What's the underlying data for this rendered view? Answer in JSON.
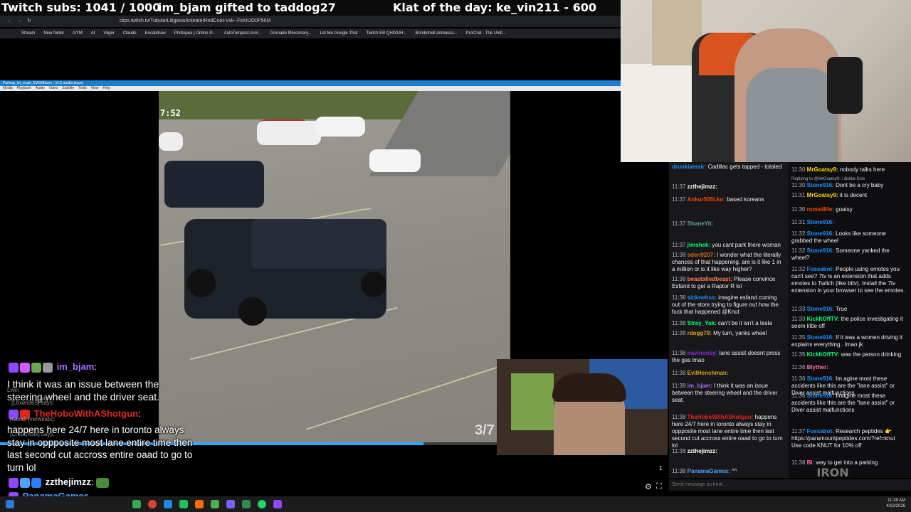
{
  "banner": {
    "subs": "Twitch subs: 1041 / 1000",
    "gift": "im_bjam gifted to taddog27",
    "klat": "Klat of the day: ke_vin211 - 600"
  },
  "browser": {
    "url": "clips.twitch.tv/TubularLitigiousAnteaterRedCoat-Vxk--FsKtUO0P56M",
    "bookmarks": [
      "Stream",
      "New folder",
      "GYM",
      "AI",
      "Vliger",
      "Claude",
      "Excalidraw",
      "Photopea | Online P...",
      "AutoTempest.com...",
      "Grenade Mercenary...",
      "Let Me Google That",
      "Twitch EB QHD/UH...",
      "Bombshell ambassa...",
      "ProChat - The Unifi..."
    ]
  },
  "vlc": {
    "title": "Parking_lot_crash_EW3rBlsmx - VLC media player",
    "menu": [
      "Media",
      "Playback",
      "Audio",
      "Video",
      "Subtitle",
      "Tools",
      "View",
      "Help"
    ],
    "timestamp": "7:52",
    "frame_label": "3/7",
    "progress": 0.85
  },
  "overlay_chat": [
    {
      "user": "im_bjam",
      "user_color": "#a970ff",
      "text": "I think it was an issue between the steering wheel and the driver seat."
    },
    {
      "user": "TheHoboWithAShotgun",
      "user_color": "#e0271f",
      "text": "happens here 24/7 here in toronto always stay in oppposite most lane entire time then last second cut accross entire oaad to go to turn lol"
    },
    {
      "user": "zzthejimzz",
      "user_color": "#ffffff",
      "text": ""
    },
    {
      "user": "PanamaGames",
      "user_color": "#4da3ff",
      "text": ""
    }
  ],
  "overlay_ghost": [
    "Lwin",
    "Cwlg",
    "[Ltown965] says:",
    "[Guild] [verwindx]:",
    "[CrustyMilk] says:"
  ],
  "overlay_number": "1",
  "chat_left": [
    {
      "time": "",
      "user": "drunkiamsir",
      "color": "#1e90ff",
      "text": "Cadillac gets tapped - totaled"
    },
    {
      "time": "11:37",
      "user": "zzthejimzz",
      "color": "#ffffff",
      "text": ""
    },
    {
      "time": "11:37",
      "user": "Ankur505Lko",
      "color": "#ff4500",
      "text": "based koreans"
    },
    {
      "time": "11:37",
      "user": "ShaneYit",
      "color": "#5f9ea0",
      "text": ""
    },
    {
      "time": "11:37",
      "user": "jimshek",
      "color": "#00ff7f",
      "text": "you cant park there woman"
    },
    {
      "time": "11:38",
      "user": "sden9207",
      "color": "#d2691e",
      "text": "I wonder what the literally chances of that happening. are is it like 1 in a million or is it like way higher?"
    },
    {
      "time": "11:38",
      "user": "beastafiedbeast",
      "color": "#ff7f50",
      "text": "Please convince Esfand to get a Raptor R lol"
    },
    {
      "time": "11:38",
      "user": "sicknehss",
      "color": "#1e90ff",
      "text": "imagine esfand coming out of the store trying to figure out how the fuck that happened @Knut"
    },
    {
      "time": "11:38",
      "user": "Stray_Yak",
      "color": "#00ff7f",
      "text": "can't be it isn't a tesla"
    },
    {
      "time": "11:38",
      "user": "rdogg79",
      "color": "#daa520",
      "text": "My turn, yanks wheel"
    },
    {
      "time": "11:38",
      "user": "navinooby",
      "color": "#8a2be2",
      "text": "lane assist doesnt press the gas lmao"
    },
    {
      "time": "11:38",
      "user": "EvilHenchman",
      "color": "#daa520",
      "text": ""
    },
    {
      "time": "11:38",
      "user": "im_bjam",
      "color": "#a970ff",
      "text": "I think it was an issue between the steering wheel and the driver seat."
    },
    {
      "time": "11:38",
      "user": "TheHoboWithAShotgun",
      "color": "#e0271f",
      "text": "happens here 24/7 here in toronto always stay in oppposite most lane entire time then last second cut accross entire oaad to go to turn lol"
    },
    {
      "time": "11:38",
      "user": "zzthejimzz",
      "color": "#ffffff",
      "text": ""
    },
    {
      "time": "11:38",
      "user": "PanamaGames",
      "color": "#4da3ff",
      "text": "^^"
    }
  ],
  "chat_right": [
    {
      "time": "11:30",
      "user": "MrGoatsy9",
      "color": "#ffd700",
      "text": "nobody talks here"
    },
    {
      "time": "",
      "user": "",
      "color": "#adadb8",
      "text": "Replying to @MrGoatsy9: i dislike Kick"
    },
    {
      "time": "11:30",
      "user": "Stone916",
      "color": "#1e90ff",
      "text": "Dont be a cry baby"
    },
    {
      "time": "11:31",
      "user": "MrGoatsy9",
      "color": "#ffd700",
      "text": "it is decent"
    },
    {
      "time": "11:30",
      "user": "rome4life",
      "color": "#ff4500",
      "text": "goatsy"
    },
    {
      "time": "11:31",
      "user": "Stone916",
      "color": "#1e90ff",
      "text": ""
    },
    {
      "time": "11:32",
      "user": "Stone916",
      "color": "#1e90ff",
      "text": "Looks like someone grabbed the wheel"
    },
    {
      "time": "11:32",
      "user": "Stone916",
      "color": "#1e90ff",
      "text": "Someone yanked the wheel?"
    },
    {
      "time": "11:32",
      "user": "Fossabot",
      "color": "#1e90ff",
      "text": "People using emotes you can't see? 7tv is an extension that adds emotes to Twitch (like bttv). Install the 7tv extension in your browser to see the emotes."
    },
    {
      "time": "11:33",
      "user": "Stone916",
      "color": "#1e90ff",
      "text": "True"
    },
    {
      "time": "11:33",
      "user": "KickItOffTV",
      "color": "#00ff7f",
      "text": "the police investigating it seem little off"
    },
    {
      "time": "11:35",
      "user": "Stone916",
      "color": "#1e90ff",
      "text": "If it was a women driving it explains everything.. lmao jk"
    },
    {
      "time": "11:35",
      "user": "KickItOffTV",
      "color": "#00ff7f",
      "text": "was the person drinking"
    },
    {
      "time": "11:36",
      "user": "Blyther",
      "color": "#ff69b4",
      "text": ""
    },
    {
      "time": "11:36",
      "user": "Stone916",
      "color": "#1e90ff",
      "text": "Im agine most these accidents like this are the \"lane assist\" or Diver assist malfunctions"
    },
    {
      "time": "11:36",
      "user": "Stone916",
      "color": "#1e90ff",
      "text": "Imagine most these accidents like this are the \"lane assist\" or Diver assist malfunctions"
    },
    {
      "time": "11:37",
      "user": "Fossabot",
      "color": "#1e90ff",
      "text": "Research peptides 👉 https://paramountpeptides.com/?ref=knut Use code KNUT for 10% off"
    },
    {
      "time": "11:38",
      "user": "Bl",
      "color": "#ff69b4",
      "text": "way to get into a parking"
    }
  ],
  "chat_input_placeholder": "Send message as knut...",
  "watermark": "IRON",
  "tray": {
    "time": "11:38 AM",
    "date": "4/13/2026"
  },
  "colors": {
    "twitch_purple": "#9147ff",
    "chat_bg": "#18181b",
    "vlc_blue": "#1a7fd0"
  }
}
